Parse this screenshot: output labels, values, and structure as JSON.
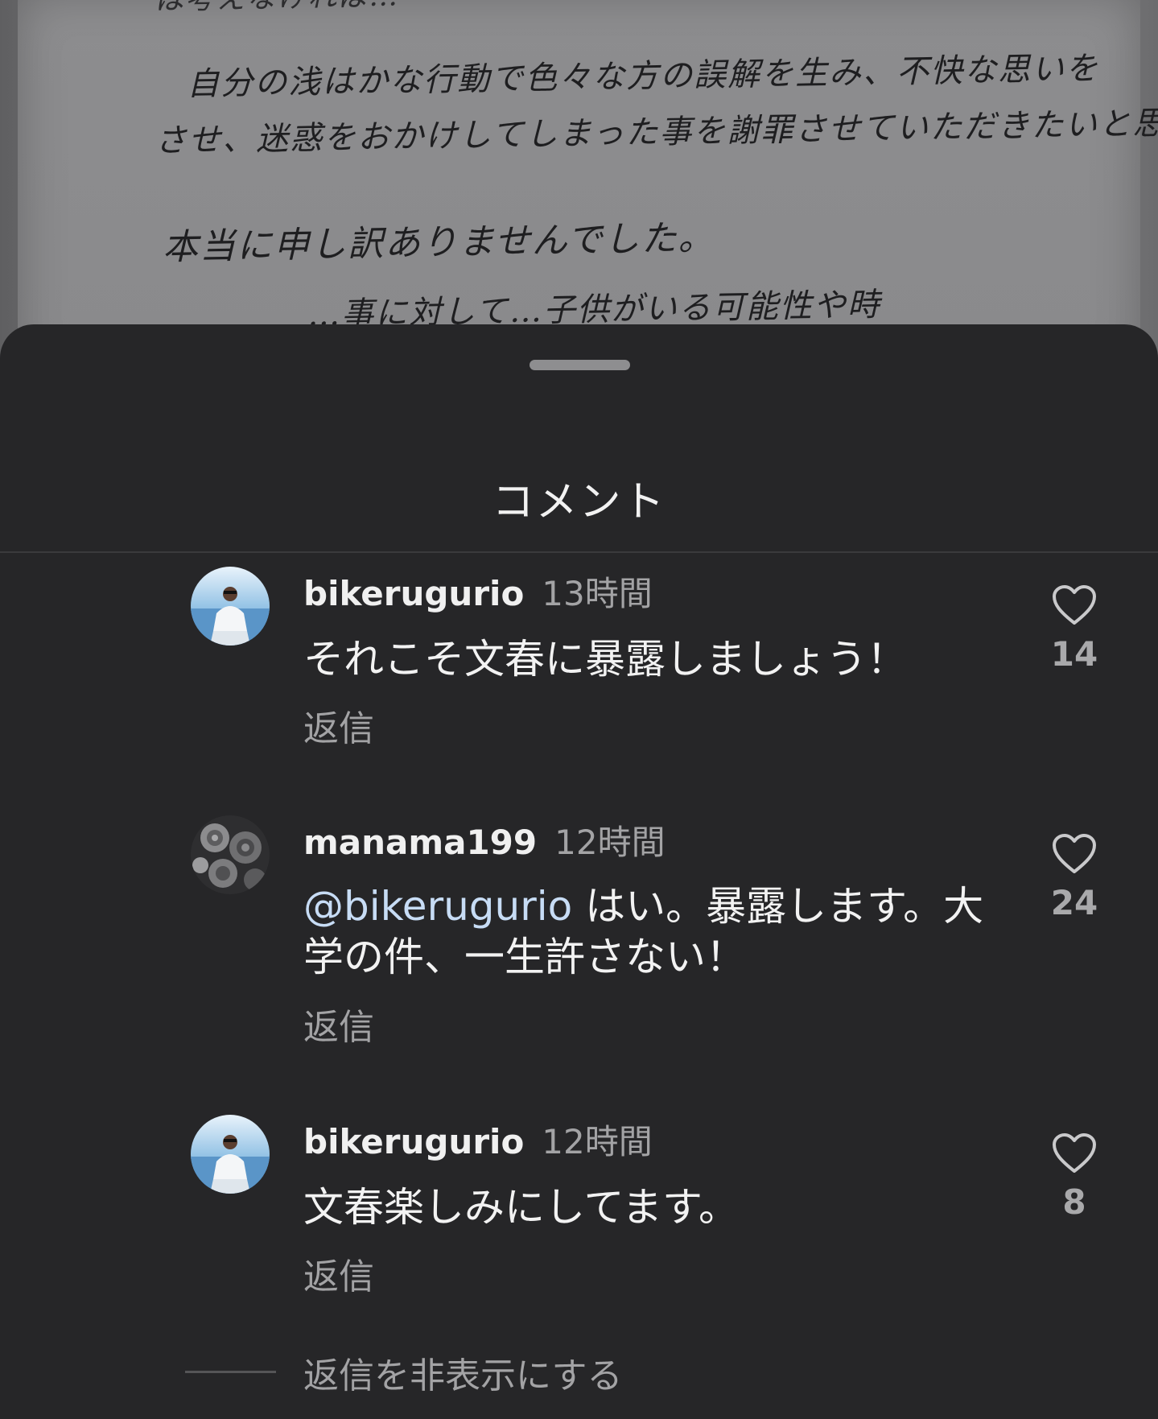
{
  "background_letter": {
    "lines": [
      "は考えなければ…",
      "自分の浅はかな行動で色々な方の誤解を生み、不快な思いを",
      "させ、迷惑をおかけしてしまった事を謝罪させていただきたいと思います。",
      "本当に申し訳ありませんでした。",
      "…事に対して…子供がいる可能性や時"
    ]
  },
  "sheet": {
    "title": "コメント"
  },
  "comments": [
    {
      "username": "bikerugurio",
      "time": "13時間",
      "text": "それこそ文春に暴露しましょう！",
      "reply_label": "返信",
      "likes": "14"
    },
    {
      "username": "manama199",
      "time": "12時間",
      "mention": "@bikerugurio",
      "text": " はい。暴露します。大学の件、一生許さない！",
      "reply_label": "返信",
      "likes": "24"
    },
    {
      "username": "bikerugurio",
      "time": "12時間",
      "text": "文春楽しみにしてます。",
      "reply_label": "返信",
      "likes": "8"
    }
  ],
  "hide_replies": {
    "label": "返信を非表示にする"
  },
  "colors": {
    "sheet_background": "#262628",
    "mention": "#c7dcf5",
    "secondary_text": "#a3a3a5"
  }
}
